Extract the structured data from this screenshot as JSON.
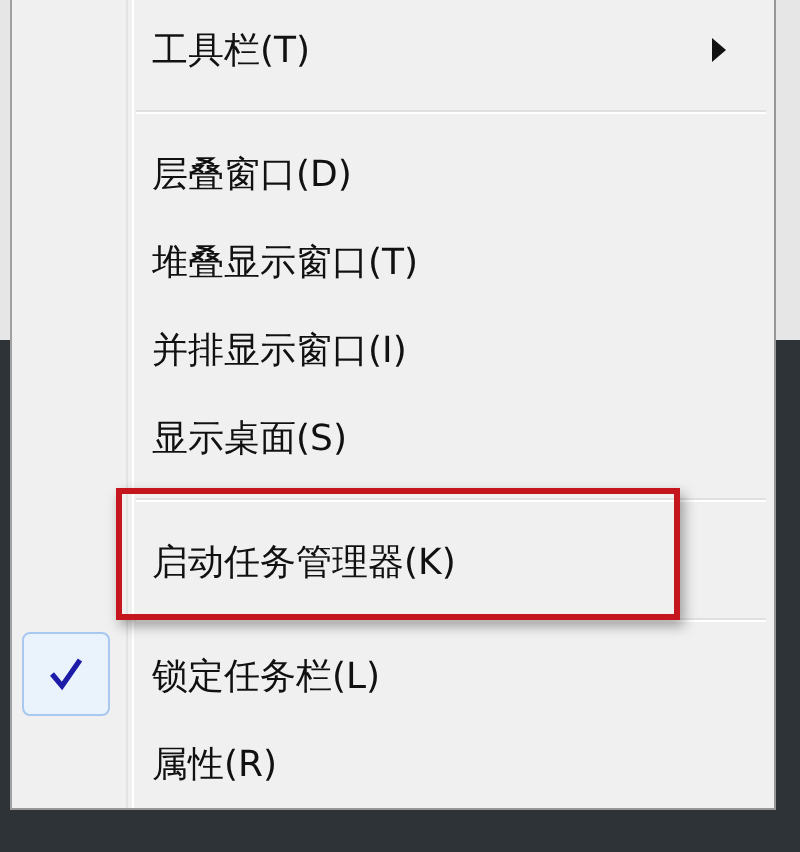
{
  "menu": {
    "items": [
      {
        "kind": "submenu",
        "label": "工具栏(T)",
        "checked": false,
        "highlighted": false
      },
      {
        "kind": "separator"
      },
      {
        "kind": "command",
        "label": "层叠窗口(D)",
        "checked": false,
        "highlighted": false
      },
      {
        "kind": "command",
        "label": "堆叠显示窗口(T)",
        "checked": false,
        "highlighted": false
      },
      {
        "kind": "command",
        "label": "并排显示窗口(I)",
        "checked": false,
        "highlighted": false
      },
      {
        "kind": "command",
        "label": "显示桌面(S)",
        "checked": false,
        "highlighted": false
      },
      {
        "kind": "separator"
      },
      {
        "kind": "command",
        "label": "启动任务管理器(K)",
        "checked": false,
        "highlighted": true
      },
      {
        "kind": "separator"
      },
      {
        "kind": "command",
        "label": "锁定任务栏(L)",
        "checked": true,
        "highlighted": false
      },
      {
        "kind": "command",
        "label": "属性(R)",
        "checked": false,
        "highlighted": false
      }
    ]
  }
}
